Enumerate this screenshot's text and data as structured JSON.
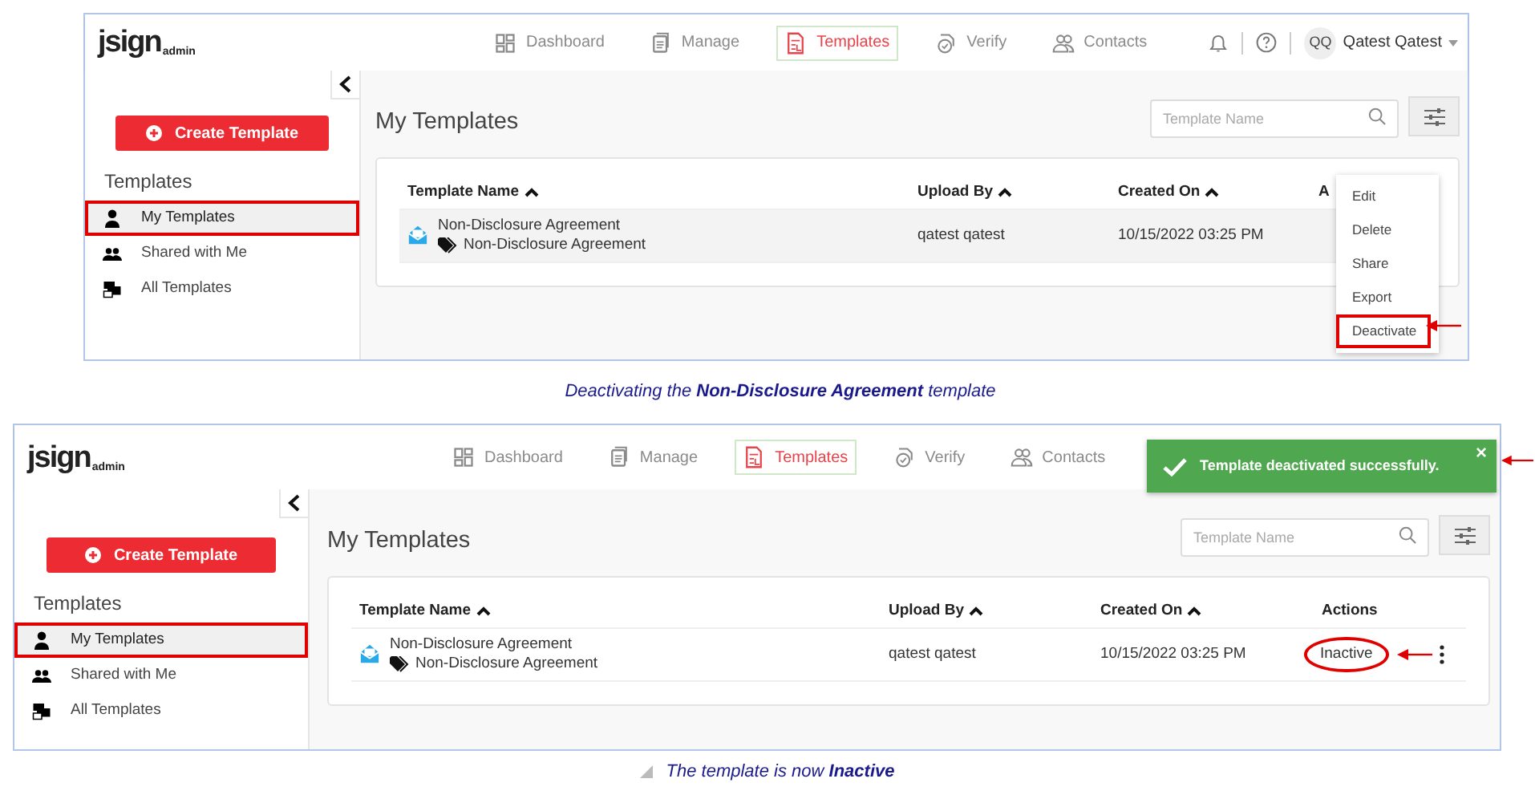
{
  "screenshots": [
    {
      "header": {
        "logo": {
          "text": "jsign",
          "sub": "admin"
        },
        "nav": [
          {
            "label": "Dashboard",
            "selected": false
          },
          {
            "label": "Manage",
            "selected": false
          },
          {
            "label": "Templates",
            "selected": true
          },
          {
            "label": "Verify",
            "selected": false
          },
          {
            "label": "Contacts",
            "selected": false
          }
        ],
        "user": {
          "initials": "QQ",
          "name": "Qatest Qatest"
        }
      },
      "sidebar": {
        "create_button": "Create Template",
        "heading": "Templates",
        "items": [
          {
            "label": "My Templates",
            "selected": true,
            "annotated": true
          },
          {
            "label": "Shared with Me",
            "selected": false,
            "annotated": false
          },
          {
            "label": "All Templates",
            "selected": false,
            "annotated": false
          }
        ]
      },
      "main": {
        "title": "My Templates",
        "search": {
          "placeholder": "Template Name"
        },
        "table": {
          "columns": [
            {
              "label": "Template Name",
              "sortable": true
            },
            {
              "label": "Upload By",
              "sortable": true
            },
            {
              "label": "Created On",
              "sortable": true
            },
            {
              "label": "A",
              "sortable": false
            }
          ],
          "rows": [
            {
              "name": "Non-Disclosure Agreement",
              "tag": "Non-Disclosure Agreement",
              "upload_by": "qatest qatest",
              "created_on": "10/15/2022 03:25 PM",
              "hovered": true
            }
          ]
        },
        "menu": [
          {
            "label": "Edit",
            "annotated": false
          },
          {
            "label": "Delete",
            "annotated": false
          },
          {
            "label": "Share",
            "annotated": false
          },
          {
            "label": "Export",
            "annotated": false
          },
          {
            "label": "Deactivate",
            "annotated": true
          }
        ]
      },
      "caption": {
        "text": "Deactivating the **Non-Disclosure Agreement** template",
        "marker": false
      }
    },
    {
      "header": {
        "logo": {
          "text": "jsign",
          "sub": "admin"
        },
        "nav": [
          {
            "label": "Dashboard",
            "selected": false
          },
          {
            "label": "Manage",
            "selected": false
          },
          {
            "label": "Templates",
            "selected": true
          },
          {
            "label": "Verify",
            "selected": false
          },
          {
            "label": "Contacts",
            "selected": false
          }
        ]
      },
      "toast": {
        "text": "Template deactivated successfully.",
        "close": "×",
        "annotated": true
      },
      "sidebar": {
        "create_button": "Create Template",
        "heading": "Templates",
        "items": [
          {
            "label": "My Templates",
            "selected": true,
            "annotated": true
          },
          {
            "label": "Shared with Me",
            "selected": false,
            "annotated": false
          },
          {
            "label": "All Templates",
            "selected": false,
            "annotated": false
          }
        ]
      },
      "main": {
        "title": "My Templates",
        "search": {
          "placeholder": "Template Name"
        },
        "table": {
          "columns": [
            {
              "label": "Template Name",
              "sortable": true
            },
            {
              "label": "Upload By",
              "sortable": true
            },
            {
              "label": "Created On",
              "sortable": true
            },
            {
              "label": "Actions",
              "sortable": false
            }
          ],
          "rows": [
            {
              "name": "Non-Disclosure Agreement",
              "tag": "Non-Disclosure Agreement",
              "upload_by": "qatest qatest",
              "created_on": "10/15/2022 03:25 PM",
              "hovered": false,
              "status": {
                "text": "Inactive",
                "annotated": true
              }
            }
          ]
        }
      },
      "caption": {
        "text": "The template is now **Inactive**",
        "marker": true
      }
    }
  ]
}
